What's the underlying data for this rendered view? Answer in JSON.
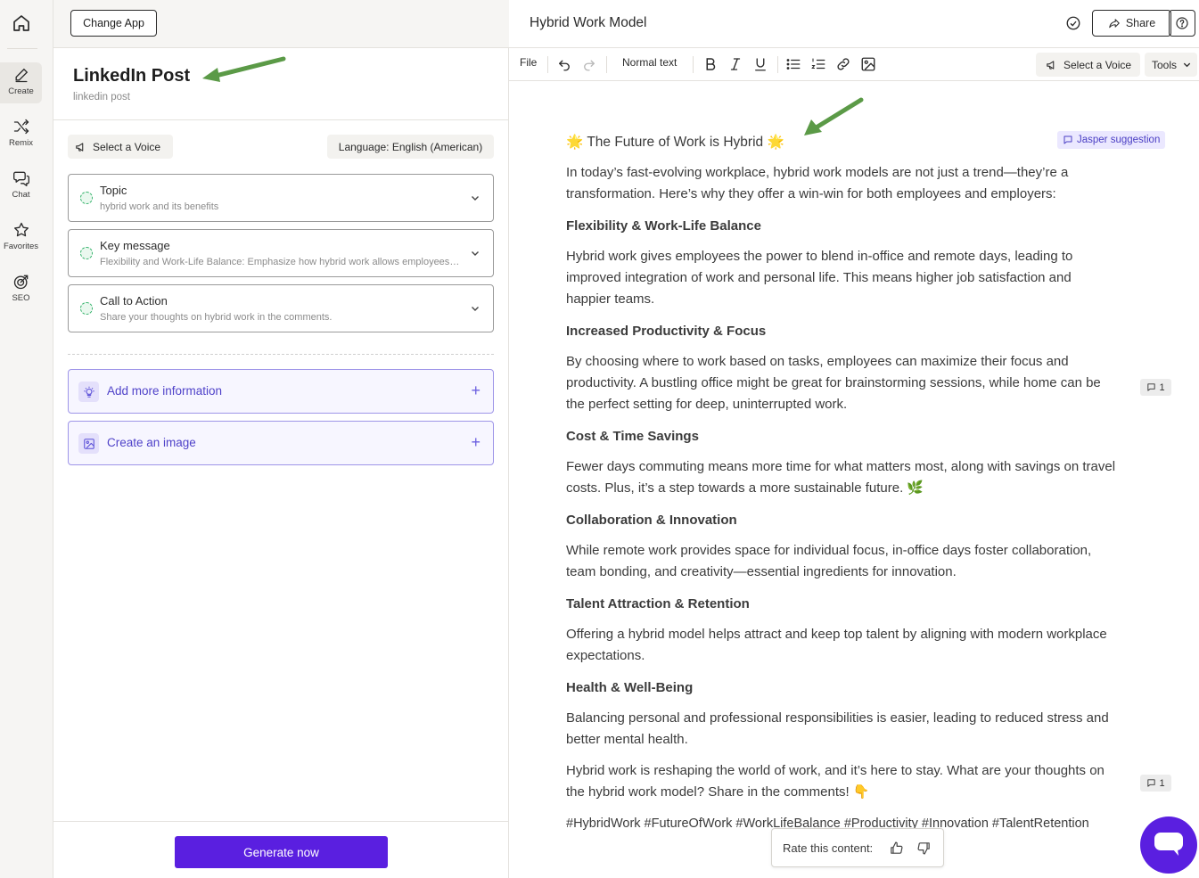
{
  "colors": {
    "accent": "#5a1fe0",
    "annotation_arrow": "#5b9a47",
    "field_dot": "#34b36b",
    "link_purple": "#4f42c9"
  },
  "rail": {
    "home_icon": "home-icon",
    "items": [
      {
        "label": "Create",
        "icon": "pen-icon",
        "active": true
      },
      {
        "label": "Remix",
        "icon": "shuffle-icon"
      },
      {
        "label": "Chat",
        "icon": "chat-bubbles-icon"
      },
      {
        "label": "Favorites",
        "icon": "star-icon"
      },
      {
        "label": "SEO",
        "icon": "target-icon"
      }
    ]
  },
  "panel": {
    "change_app": "Change App",
    "app_title": "LinkedIn Post",
    "app_subtitle": "linkedin post",
    "select_voice": "Select a Voice",
    "language": "Language: English (American)",
    "fields": [
      {
        "label": "Topic",
        "value": "hybrid work and its benefits"
      },
      {
        "label": "Key message",
        "value": "Flexibility and Work-Life Balance: Emphasize how hybrid work allows employees to achieve a better work-life balance"
      },
      {
        "label": "Call to Action",
        "value": "Share your thoughts on hybrid work in the comments."
      }
    ],
    "add_more": "Add more information",
    "create_image": "Create an image",
    "generate": "Generate now"
  },
  "editor": {
    "doc_title": "Hybrid Work Model",
    "share": "Share",
    "toolbar": {
      "file": "File",
      "text_style": "Normal text",
      "select_voice": "Select a Voice",
      "tools": "Tools"
    },
    "jasper_suggestion": "Jasper suggestion",
    "comment_count": "1",
    "content": {
      "title": "🌟 The Future of Work is Hybrid 🌟",
      "intro": [
        "In today’s fast-evolving workplace, hybrid work models are not just a trend—they’re a",
        "transformation. Here’s why they offer a win-win for both employees and employers:"
      ],
      "h1": "Flexibility & Work-Life Balance",
      "p1": [
        "Hybrid work gives employees the power to blend in-office and remote days, leading to",
        "improved integration of work and personal life. This means higher job satisfaction and",
        "happier teams."
      ],
      "h2": "Increased Productivity & Focus",
      "p2": [
        "By choosing where to work based on tasks, employees can maximize their focus and",
        "productivity. A bustling office might be great for brainstorming sessions, while home can be",
        "the perfect setting for deep, uninterrupted work."
      ],
      "h3": "Cost & Time Savings",
      "p3": [
        "Fewer days commuting means more time for what matters most, along with savings on travel",
        "costs. Plus, it’s a step towards a more sustainable future. 🌿"
      ],
      "h4": "Collaboration & Innovation",
      "p4": [
        "While remote work provides space for individual focus, in-office days foster collaboration,",
        "team bonding, and creativity—essential ingredients for innovation."
      ],
      "h5": "Talent Attraction & Retention",
      "p5": [
        "Offering a hybrid model helps attract and keep top talent by aligning with modern workplace",
        "expectations."
      ],
      "h6": "Health & Well-Being",
      "p6": [
        "Balancing personal and professional responsibilities is easier, leading to reduced stress and",
        "better mental health."
      ],
      "closing": [
        "Hybrid work is reshaping the world of work, and it’s here to stay. What are your thoughts on",
        "the hybrid work model? Share in the comments! 👇"
      ],
      "hashtags": "#HybridWork #FutureOfWork #WorkLifeBalance #Productivity #Innovation #TalentRetention"
    },
    "rate_label": "Rate this content:"
  }
}
